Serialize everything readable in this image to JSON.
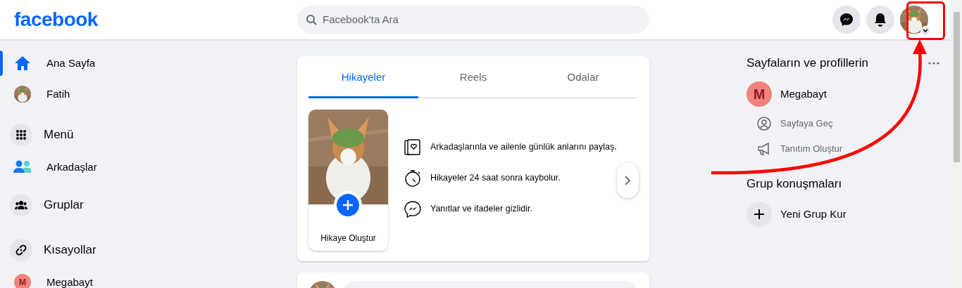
{
  "header": {
    "logo": "facebook",
    "search": {
      "placeholder": "Facebook'ta Ara"
    }
  },
  "sidebar": {
    "items": [
      {
        "kind": "home",
        "label": "Ana Sayfa",
        "selected": true
      },
      {
        "kind": "avatar",
        "label": "Fatih",
        "selected": false
      },
      {
        "kind": "menu",
        "label": "Menü",
        "selected": false
      },
      {
        "kind": "friends",
        "label": "Arkadaşlar",
        "selected": false
      },
      {
        "kind": "groups",
        "label": "Gruplar",
        "selected": false
      },
      {
        "kind": "shortcuts",
        "label": "Kısayollar",
        "selected": false
      },
      {
        "kind": "letter",
        "label": "Megabayt",
        "letter": "M",
        "selected": false
      }
    ]
  },
  "stories": {
    "tabs": [
      {
        "label": "Hikayeler",
        "selected": true
      },
      {
        "label": "Reels",
        "selected": false
      },
      {
        "label": "Odalar",
        "selected": false
      }
    ],
    "create_label": "Hikaye Oluştur",
    "tips": [
      {
        "kind": "cards",
        "text": "Arkadaşlarınla ve ailenle günlük anlarını paylaş."
      },
      {
        "kind": "timer",
        "text": "Hikayeler 24 saat sonra kaybolur."
      },
      {
        "kind": "messenger",
        "text": "Yanıtlar ve ifadeler gizlidir."
      }
    ]
  },
  "right": {
    "pages_title": "Sayfaların ve profillerin",
    "page": {
      "letter": "M",
      "name": "Megabayt"
    },
    "page_actions": [
      {
        "kind": "switch",
        "label": "Sayfaya Geç"
      },
      {
        "kind": "promote",
        "label": "Tanıtım Oluştur"
      }
    ],
    "groups_title": "Grup konuşmaları",
    "new_group": "Yeni Grup Kur"
  }
}
